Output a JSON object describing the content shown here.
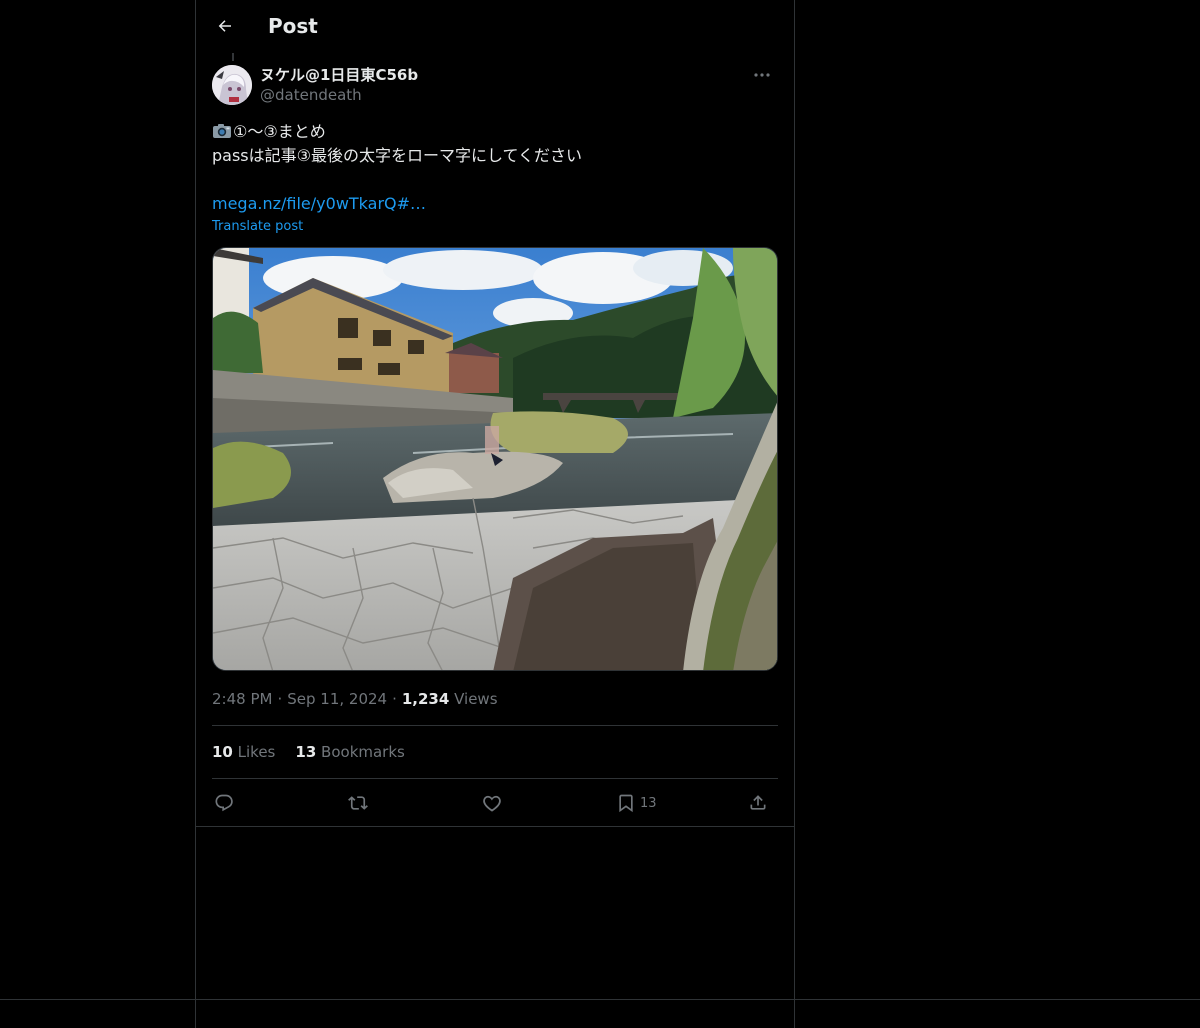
{
  "header": {
    "title": "Post"
  },
  "author": {
    "display_name": "ヌケル@1日目東C56b",
    "handle": "@datendeath"
  },
  "post": {
    "lines": [
      "①〜③まとめ",
      "passは記事③最後の太字をローマ字にしてください"
    ],
    "link_text": "mega.nz/file/y0wTkarQ#…",
    "translate_label": "Translate post"
  },
  "meta": {
    "time": "2:48 PM",
    "separator": "·",
    "date": "Sep 11, 2024",
    "views_count": "1,234",
    "views_label": "Views"
  },
  "stats": {
    "likes_count": "10",
    "likes_label": "Likes",
    "bookmarks_count": "13",
    "bookmarks_label": "Bookmarks"
  },
  "actions": [
    {
      "icon": "reply-icon"
    },
    {
      "icon": "repost-icon"
    },
    {
      "icon": "like-icon"
    },
    {
      "icon": "bookmark-icon",
      "count": "13"
    },
    {
      "icon": "share-icon"
    }
  ],
  "colors": {
    "background": "#000000",
    "text": "#e7e9ea",
    "muted": "#71767b",
    "link": "#1d9bf0",
    "border": "#2f3336"
  }
}
